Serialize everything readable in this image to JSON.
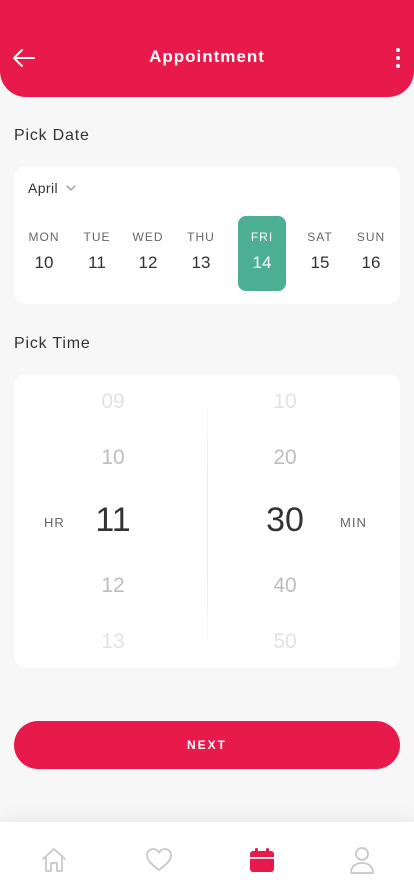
{
  "header": {
    "title": "Appointment"
  },
  "date_section": {
    "title": "Pick Date",
    "month": "April",
    "days": [
      {
        "name": "MON",
        "num": "10",
        "selected": false
      },
      {
        "name": "TUE",
        "num": "11",
        "selected": false
      },
      {
        "name": "WED",
        "num": "12",
        "selected": false
      },
      {
        "name": "THU",
        "num": "13",
        "selected": false
      },
      {
        "name": "FRI",
        "num": "14",
        "selected": true
      },
      {
        "name": "SAT",
        "num": "15",
        "selected": false
      },
      {
        "name": "SUN",
        "num": "16",
        "selected": false
      }
    ]
  },
  "time_section": {
    "title": "Pick Time",
    "hour_label": "HR",
    "minute_label": "MIN",
    "hours": [
      "09",
      "10",
      "11",
      "12",
      "13"
    ],
    "minutes": [
      "10",
      "20",
      "30",
      "40",
      "50"
    ],
    "selected_hour": "11",
    "selected_minute": "30"
  },
  "next_button": {
    "label": "NEXT"
  },
  "bottom_nav": {
    "items": [
      {
        "name": "home",
        "icon": "home-icon",
        "active": false
      },
      {
        "name": "favorites",
        "icon": "heart-icon",
        "active": false
      },
      {
        "name": "calendar",
        "icon": "calendar-icon",
        "active": true
      },
      {
        "name": "profile",
        "icon": "user-icon",
        "active": false
      }
    ]
  },
  "colors": {
    "primary": "#e8194b",
    "selected_day": "#4caf93",
    "background": "#f7f7f7",
    "inactive_icon": "#c8c8c8"
  }
}
